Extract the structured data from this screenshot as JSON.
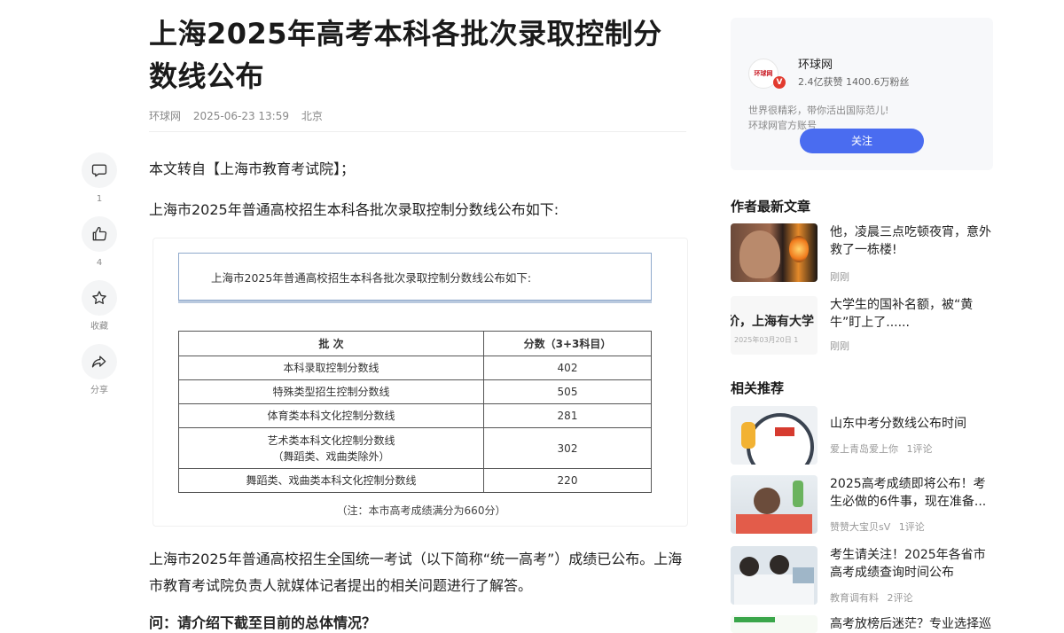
{
  "article": {
    "title": "上海2025年高考本科各批次录取控制分数线公布",
    "source": "环球网",
    "datetime": "2025-06-23 13:59",
    "location": "北京",
    "para1": "本文转自【上海市教育考试院】；",
    "para2": "上海市2025年普通高校招生本科各批次录取控制分数线公布如下:",
    "para3": "上海市2025年普通高校招生全国统一考试（以下简称“统一高考”）成绩已公布。上海市教育考试院负责人就媒体记者提出的相关问题进行了解答。",
    "question": "问：请介绍下截至目前的总体情况？"
  },
  "image_card": {
    "callout": "上海市2025年普通高校招生本科各批次录取控制分数线公布如下:",
    "table": {
      "headers": [
        "批 次",
        "分数（3+3科目）"
      ],
      "rows": [
        {
          "name": "本科录取控制分数线",
          "name2": "",
          "score": "402"
        },
        {
          "name": "特殊类型招生控制分数线",
          "name2": "",
          "score": "505"
        },
        {
          "name": "体育类本科文化控制分数线",
          "name2": "",
          "score": "281"
        },
        {
          "name": "艺术类本科文化控制分数线",
          "name2": "（舞蹈类、戏曲类除外）",
          "score": "302"
        },
        {
          "name": "舞蹈类、戏曲类本科文化控制分数线",
          "name2": "",
          "score": "220"
        }
      ]
    },
    "note": "（注：本市高考成绩满分为660分）"
  },
  "actions": {
    "comment_count": "1",
    "like_count": "4",
    "collect_label": "收藏",
    "share_label": "分享"
  },
  "author": {
    "avatar_text": "环球网",
    "badge": "V",
    "name": "环球网",
    "stats": "2.4亿获赞 1400.6万粉丝",
    "desc_line1": "世界很精彩，带你活出国际范儿!",
    "desc_line2": "环球网官方账号",
    "follow_label": "关注"
  },
  "sidebar": {
    "latest_title": "作者最新文章",
    "latest": [
      {
        "title": "他，凌晨三点吃顿夜宵，意外救了一栋楼!",
        "time": "刚刚",
        "thumb": "fire"
      },
      {
        "title": "大学生的国补名额，被“黄牛”盯上了......",
        "time": "刚刚",
        "thumb": "text",
        "thumb_big": "价，上海有大学",
        "thumb_small": "2025年03月20日 1"
      }
    ],
    "related_title": "相关推荐",
    "related": [
      {
        "title": "山东中考分数线公布时间",
        "author": "爱上青岛爱上你",
        "comments": "1评论",
        "thumb": "clock"
      },
      {
        "title": "2025高考成绩即将公布！考生必做的6件事，现在准备...",
        "author": "赞赞大宝贝sV",
        "comments": "1评论",
        "thumb": "study"
      },
      {
        "title": "考生请关注！2025年各省市高考成绩查询时间公布",
        "author": "教育调有料",
        "comments": "2评论",
        "thumb": "class"
      },
      {
        "title": "高考放榜后迷茫？专业选择巡",
        "author": "",
        "comments": "",
        "thumb": "green"
      }
    ]
  },
  "colors": {
    "accent": "#4a6cf0",
    "rail_bg": "#f4f5f6",
    "card_bg": "#f7f8fa"
  }
}
